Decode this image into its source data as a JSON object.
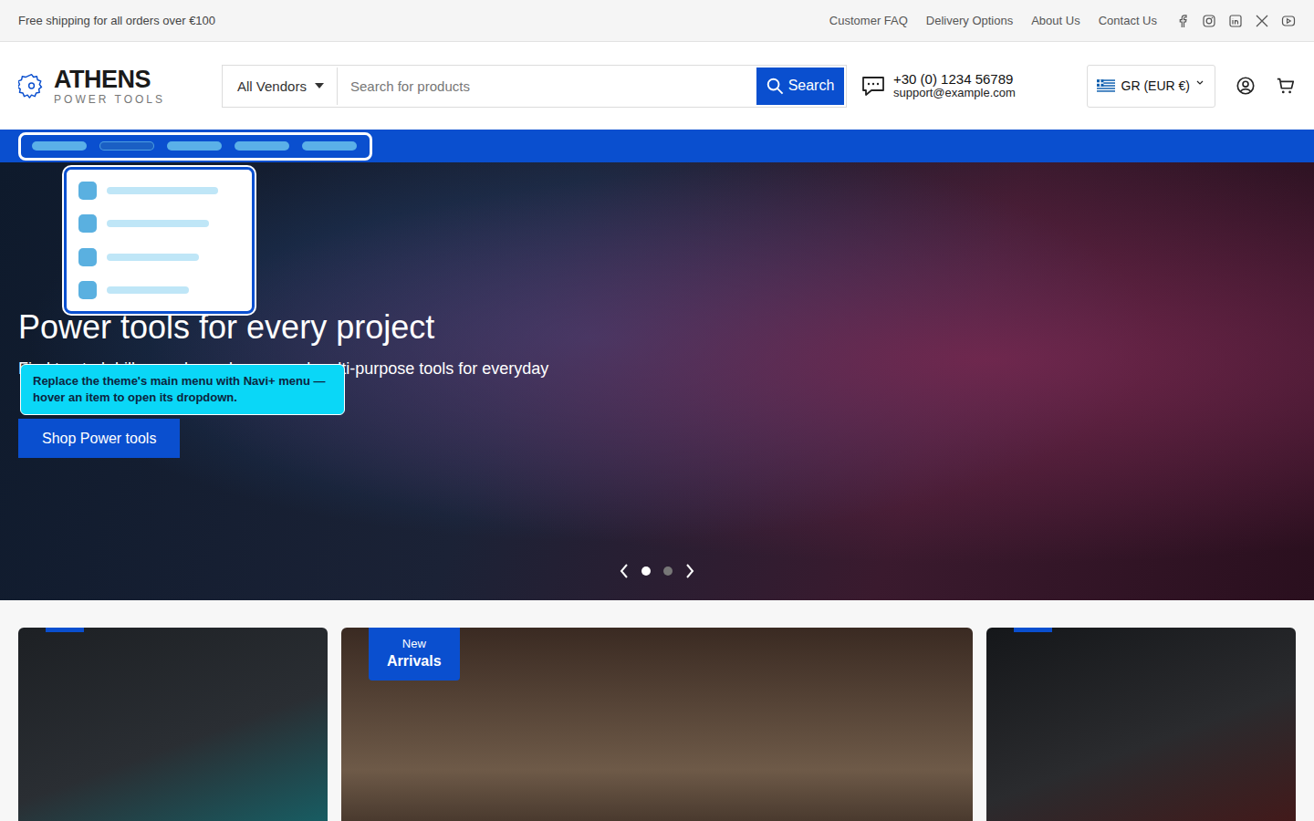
{
  "topbar": {
    "promo": "Free shipping for all orders over €100",
    "links": [
      "Customer FAQ",
      "Delivery Options",
      "About Us",
      "Contact Us"
    ]
  },
  "logo": {
    "name": "ATHENS",
    "tagline": "POWER TOOLS"
  },
  "search": {
    "vendor": "All Vendors",
    "placeholder": "Search for products",
    "button": "Search"
  },
  "contact": {
    "phone": "+30 (0) 1234 56789",
    "email": "support@example.com"
  },
  "currency": "GR (EUR €)",
  "menu_preview": {
    "pills": [
      {
        "selected": false
      },
      {
        "selected": true
      },
      {
        "selected": false
      },
      {
        "selected": false
      },
      {
        "selected": false
      }
    ],
    "dropdown": [
      {
        "level": 1
      },
      {
        "level": 0.92
      },
      {
        "level": 0.83
      },
      {
        "level": 0.74
      }
    ]
  },
  "tooltip": "Replace the theme's main menu with Navi+ menu — hover an item to open its dropdown.",
  "hero": {
    "title": "Power tools for every project",
    "subtitle": "Find trusted drills, sanders, planers, and multi-purpose tools for everyday",
    "button": "Shop Power tools",
    "slides": [
      {
        "selected": true
      },
      {
        "selected": false
      }
    ]
  },
  "cards": [
    {
      "kind": "tab"
    },
    {
      "kind": "badge",
      "badge_top": "New",
      "badge_bottom": "Arrivals"
    },
    {
      "kind": "tab"
    }
  ]
}
